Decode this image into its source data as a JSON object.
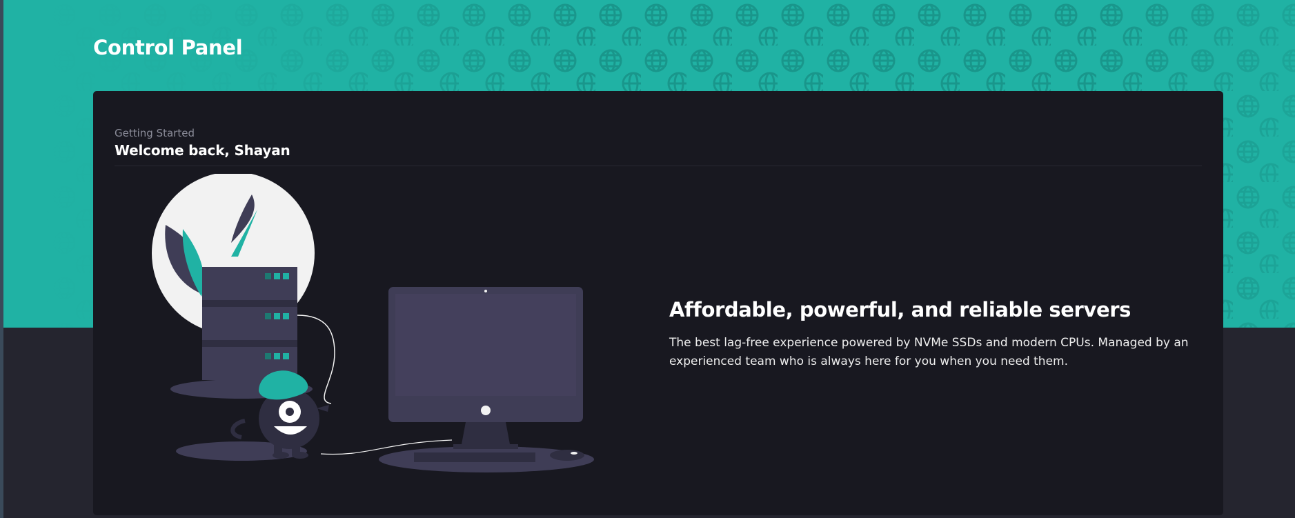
{
  "header": {
    "title": "Control Panel"
  },
  "card": {
    "subtitle": "Getting Started",
    "title": "Welcome back, Shayan"
  },
  "promo": {
    "heading": "Affordable, powerful, and reliable servers",
    "text": "The best lag-free experience powered by NVMe SSDs and modern CPUs. Managed by an experienced team who is always here for you when you need them."
  },
  "colors": {
    "accent": "#20b2a4",
    "card_bg": "#181820",
    "page_bg": "#25252f"
  },
  "icons": {
    "background_pattern": "globe-icon"
  }
}
